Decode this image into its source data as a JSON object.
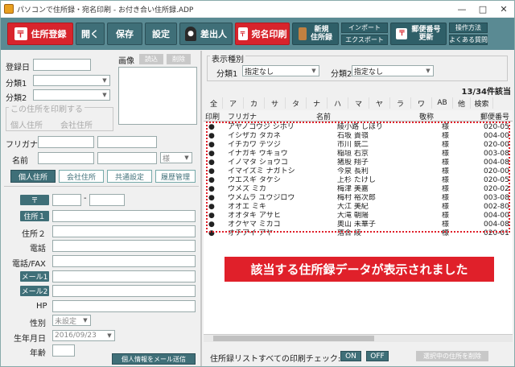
{
  "window": {
    "title": "パソコンで住所録・宛名印刷 - お付き合い住所録.ADP",
    "min": "—",
    "max": "□",
    "close": "✕"
  },
  "toolbar": {
    "register": "住所登録",
    "open": "開く",
    "save": "保存",
    "settings": "設定",
    "sender": "差出人",
    "print": "宛名印刷",
    "new_book": "新規\n住所録",
    "import": "インポート",
    "export": "エクスポート",
    "postal": "郵便番号\n更新",
    "howto": "操作方法",
    "faq": "よくある質問"
  },
  "left": {
    "reg_date": "登録日",
    "photo": "画像",
    "photo_input": "読込",
    "photo_delete": "削除",
    "cat1": "分類1",
    "cat2": "分類2",
    "print_this": "この住所を印刷する",
    "personal_addr": "個人住所",
    "company_addr": "会社住所",
    "furigana": "フリガナ",
    "name": "名前",
    "honorific": "様",
    "tab_personal": "個人住所",
    "tab_company": "会社住所",
    "tab_common": "共通設定",
    "tab_history": "履歴管理",
    "postal_mark": "〒",
    "addr1": "住所１",
    "addr2": "住所２",
    "phone": "電話",
    "phone_fax": "電話/FAX",
    "mail1": "メール1",
    "mail2": "メール2",
    "hp": "HP",
    "gender": "性別",
    "gender_val": "未設定",
    "birth": "生年月日",
    "birth_val": "2016/09/23",
    "age": "年齢",
    "send_mail": "個人情報をメール送信"
  },
  "right": {
    "cat_label": "表示種別",
    "cat1": "分類1",
    "cat1_val": "指定なし",
    "cat2": "分類2",
    "cat2_val": "指定なし",
    "count": "13/34件該当",
    "kana": [
      "全",
      "ア",
      "カ",
      "サ",
      "タ",
      "ナ",
      "ハ",
      "マ",
      "ヤ",
      "ラ",
      "ワ",
      "AB",
      "他",
      "検索"
    ],
    "col_print": "印刷",
    "col_furi": "フリガナ",
    "col_name": "名前",
    "col_hon": "敬称",
    "col_zip": "郵便番号",
    "rows": [
      {
        "f": "アヤノコウジ シホリ",
        "n": "綾小路 しほり",
        "h": "様",
        "z": "020-05"
      },
      {
        "f": "イシザカ タカネ",
        "n": "石坂 貴嶺",
        "h": "様",
        "z": "004-00"
      },
      {
        "f": "イチカワ テツジ",
        "n": "市川 銑二",
        "h": "様",
        "z": "020-00"
      },
      {
        "f": "イナガキ ウキョウ",
        "n": "稲垣 右京",
        "h": "様",
        "z": "003-08"
      },
      {
        "f": "イノマタ ショウコ",
        "n": "猪股 翔子",
        "h": "様",
        "z": "004-08"
      },
      {
        "f": "イマイズミ ナガトシ",
        "n": "今泉 長利",
        "h": "様",
        "z": "020-00"
      },
      {
        "f": "ウエスギ タケシ",
        "n": "上杉 たけし",
        "h": "様",
        "z": "020-05"
      },
      {
        "f": "ウメズ ミカ",
        "n": "梅津 美嘉",
        "h": "様",
        "z": "020-02"
      },
      {
        "f": "ウメムラ ユウジロウ",
        "n": "梅村 裕次郎",
        "h": "様",
        "z": "003-08"
      },
      {
        "f": "オオエ ミキ",
        "n": "大江 美紀",
        "h": "様",
        "z": "002-80"
      },
      {
        "f": "オオタキ アサヒ",
        "n": "大滝 朝陽",
        "h": "様",
        "z": "004-00"
      },
      {
        "f": "オクヤマ ミカコ",
        "n": "奥山 未華子",
        "h": "様",
        "z": "004-08"
      },
      {
        "f": "オチアイ アヤ",
        "n": "落合 綾",
        "h": "様",
        "z": "020-01"
      }
    ],
    "banner": "該当する住所録データが表示されました",
    "print_check": "住所録リストすべての印刷チェック:",
    "on": "ON",
    "off": "OFF",
    "delete_selected": "選択中の住所を削除"
  }
}
